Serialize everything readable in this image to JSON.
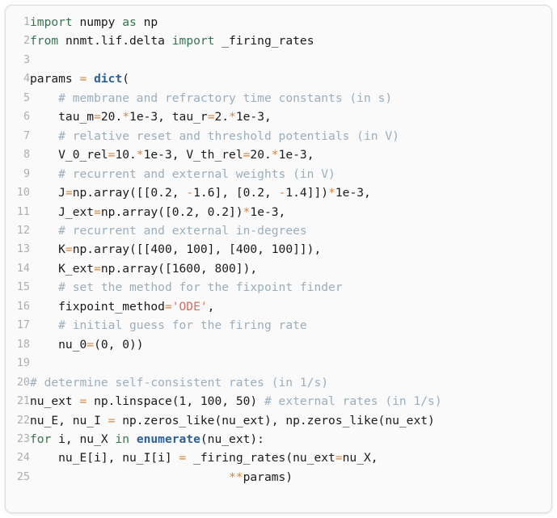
{
  "card": {
    "kind": "code-block",
    "language": "python",
    "background": "#fafafa",
    "border_color": "#dcdcdc"
  },
  "theme": {
    "keyword": "#34754f",
    "builtin": "#2b6099",
    "operator": "#d9833b",
    "comment": "#9aaebb",
    "string": "#d96a5c",
    "text": "#1a1a1a",
    "line_number": "#aeaeae"
  },
  "code": {
    "line_numbers": [
      "1",
      "2",
      "3",
      "4",
      "5",
      "6",
      "7",
      "8",
      "9",
      "10",
      "11",
      "12",
      "13",
      "14",
      "15",
      "16",
      "17",
      "18",
      "19",
      "20",
      "21",
      "22",
      "23",
      "24",
      "25"
    ],
    "lines": [
      [
        {
          "t": "k",
          "v": "import"
        },
        {
          "t": "n",
          "v": " numpy "
        },
        {
          "t": "k",
          "v": "as"
        },
        {
          "t": "n",
          "v": " np"
        }
      ],
      [
        {
          "t": "k",
          "v": "from"
        },
        {
          "t": "n",
          "v": " nnmt.lif.delta "
        },
        {
          "t": "k",
          "v": "import"
        },
        {
          "t": "n",
          "v": " _firing_rates"
        }
      ],
      [],
      [
        {
          "t": "n",
          "v": "params "
        },
        {
          "t": "o",
          "v": "="
        },
        {
          "t": "n",
          "v": " "
        },
        {
          "t": "kb",
          "v": "dict"
        },
        {
          "t": "n",
          "v": "("
        }
      ],
      [
        {
          "t": "n",
          "v": "    "
        },
        {
          "t": "c",
          "v": "# membrane and refractory time constants (in s)"
        }
      ],
      [
        {
          "t": "n",
          "v": "    tau_m"
        },
        {
          "t": "o",
          "v": "="
        },
        {
          "t": "n",
          "v": "20."
        },
        {
          "t": "o",
          "v": "*"
        },
        {
          "t": "n",
          "v": "1e-3, tau_r"
        },
        {
          "t": "o",
          "v": "="
        },
        {
          "t": "n",
          "v": "2."
        },
        {
          "t": "o",
          "v": "*"
        },
        {
          "t": "n",
          "v": "1e-3,"
        }
      ],
      [
        {
          "t": "n",
          "v": "    "
        },
        {
          "t": "c",
          "v": "# relative reset and threshold potentials (in V)"
        }
      ],
      [
        {
          "t": "n",
          "v": "    V_0_rel"
        },
        {
          "t": "o",
          "v": "="
        },
        {
          "t": "n",
          "v": "10."
        },
        {
          "t": "o",
          "v": "*"
        },
        {
          "t": "n",
          "v": "1e-3, V_th_rel"
        },
        {
          "t": "o",
          "v": "="
        },
        {
          "t": "n",
          "v": "20."
        },
        {
          "t": "o",
          "v": "*"
        },
        {
          "t": "n",
          "v": "1e-3,"
        }
      ],
      [
        {
          "t": "n",
          "v": "    "
        },
        {
          "t": "c",
          "v": "# recurrent and external weights (in V)"
        }
      ],
      [
        {
          "t": "n",
          "v": "    J"
        },
        {
          "t": "o",
          "v": "="
        },
        {
          "t": "n",
          "v": "np.array([[0.2, "
        },
        {
          "t": "o",
          "v": "-"
        },
        {
          "t": "n",
          "v": "1.6], [0.2, "
        },
        {
          "t": "o",
          "v": "-"
        },
        {
          "t": "n",
          "v": "1.4]])"
        },
        {
          "t": "o",
          "v": "*"
        },
        {
          "t": "n",
          "v": "1e-3,"
        }
      ],
      [
        {
          "t": "n",
          "v": "    J_ext"
        },
        {
          "t": "o",
          "v": "="
        },
        {
          "t": "n",
          "v": "np.array([0.2, 0.2])"
        },
        {
          "t": "o",
          "v": "*"
        },
        {
          "t": "n",
          "v": "1e-3,"
        }
      ],
      [
        {
          "t": "n",
          "v": "    "
        },
        {
          "t": "c",
          "v": "# recurrent and external in-degrees"
        }
      ],
      [
        {
          "t": "n",
          "v": "    K"
        },
        {
          "t": "o",
          "v": "="
        },
        {
          "t": "n",
          "v": "np.array([[400, 100], [400, 100]]),"
        }
      ],
      [
        {
          "t": "n",
          "v": "    K_ext"
        },
        {
          "t": "o",
          "v": "="
        },
        {
          "t": "n",
          "v": "np.array([1600, 800]),"
        }
      ],
      [
        {
          "t": "n",
          "v": "    "
        },
        {
          "t": "c",
          "v": "# set the method for the fixpoint finder"
        }
      ],
      [
        {
          "t": "n",
          "v": "    fixpoint_method"
        },
        {
          "t": "o",
          "v": "="
        },
        {
          "t": "s",
          "v": "'ODE'"
        },
        {
          "t": "n",
          "v": ","
        }
      ],
      [
        {
          "t": "n",
          "v": "    "
        },
        {
          "t": "c",
          "v": "# initial guess for the firing rate"
        }
      ],
      [
        {
          "t": "n",
          "v": "    nu_0"
        },
        {
          "t": "o",
          "v": "="
        },
        {
          "t": "n",
          "v": "(0, 0))"
        }
      ],
      [],
      [
        {
          "t": "c",
          "v": "# determine self-consistent rates (in 1/s)"
        }
      ],
      [
        {
          "t": "n",
          "v": "nu_ext "
        },
        {
          "t": "o",
          "v": "="
        },
        {
          "t": "n",
          "v": " np.linspace(1, 100, 50) "
        },
        {
          "t": "c",
          "v": "# external rates (in 1/s)"
        }
      ],
      [
        {
          "t": "n",
          "v": "nu_E, nu_I "
        },
        {
          "t": "o",
          "v": "="
        },
        {
          "t": "n",
          "v": " np.zeros_like(nu_ext), np.zeros_like(nu_ext)"
        }
      ],
      [
        {
          "t": "k",
          "v": "for"
        },
        {
          "t": "n",
          "v": " i, nu_X "
        },
        {
          "t": "k",
          "v": "in"
        },
        {
          "t": "n",
          "v": " "
        },
        {
          "t": "kb",
          "v": "enumerate"
        },
        {
          "t": "n",
          "v": "(nu_ext):"
        }
      ],
      [
        {
          "t": "n",
          "v": "    nu_E[i], nu_I[i] "
        },
        {
          "t": "o",
          "v": "="
        },
        {
          "t": "n",
          "v": " _firing_rates(nu_ext"
        },
        {
          "t": "o",
          "v": "="
        },
        {
          "t": "n",
          "v": "nu_X,"
        }
      ],
      [
        {
          "t": "n",
          "v": "                            "
        },
        {
          "t": "o",
          "v": "**"
        },
        {
          "t": "n",
          "v": "params)"
        }
      ]
    ],
    "plain_text": "import numpy as np\nfrom nnmt.lif.delta import _firing_rates\n\nparams = dict(\n    # membrane and refractory time constants (in s)\n    tau_m=20.*1e-3, tau_r=2.*1e-3,\n    # relative reset and threshold potentials (in V)\n    V_0_rel=10.*1e-3, V_th_rel=20.*1e-3,\n    # recurrent and external weights (in V)\n    J=np.array([[0.2, -1.6], [0.2, -1.4]])*1e-3,\n    J_ext=np.array([0.2, 0.2])*1e-3,\n    # recurrent and external in-degrees\n    K=np.array([[400, 100], [400, 100]]),\n    K_ext=np.array([1600, 800]),\n    # set the method for the fixpoint finder\n    fixpoint_method='ODE',\n    # initial guess for the firing rate\n    nu_0=(0, 0))\n\n# determine self-consistent rates (in 1/s)\nnu_ext = np.linspace(1, 100, 50) # external rates (in 1/s)\nnu_E, nu_I = np.zeros_like(nu_ext), np.zeros_like(nu_ext)\nfor i, nu_X in enumerate(nu_ext):\n    nu_E[i], nu_I[i] = _firing_rates(nu_ext=nu_X,\n                            **params)"
  }
}
